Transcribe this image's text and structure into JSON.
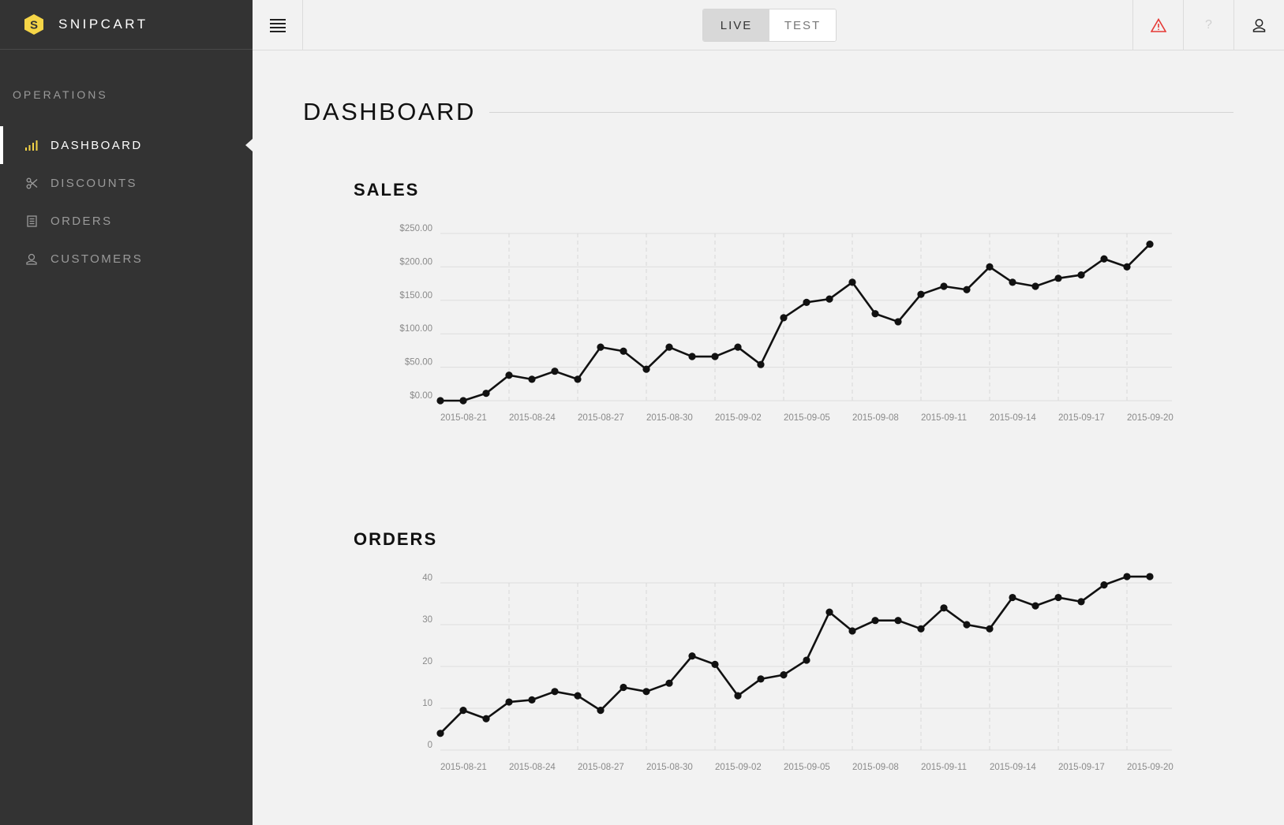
{
  "app": {
    "brand": "SNIPCART",
    "accent": "#f5d547"
  },
  "sidebar": {
    "section_label": "OPERATIONS",
    "items": [
      {
        "label": "DASHBOARD",
        "icon": "bar-chart-icon",
        "active": true
      },
      {
        "label": "DISCOUNTS",
        "icon": "scissors-icon",
        "active": false
      },
      {
        "label": "ORDERS",
        "icon": "receipt-icon",
        "active": false
      },
      {
        "label": "CUSTOMERS",
        "icon": "user-icon",
        "active": false
      }
    ]
  },
  "topbar": {
    "mode_live": "LIVE",
    "mode_test": "TEST",
    "selected_mode": "LIVE",
    "icons": [
      "menu-icon",
      "alert-icon",
      "help-icon",
      "user-icon"
    ],
    "help_glyph": "?",
    "alert_color": "#e53935"
  },
  "main": {
    "page_title": "DASHBOARD"
  },
  "charts": {
    "sales_title": "SALES",
    "orders_title": "ORDERS"
  },
  "chart_data": [
    {
      "type": "line",
      "title": "SALES",
      "x_ticks": [
        "2015-08-21",
        "2015-08-24",
        "2015-08-27",
        "2015-08-30",
        "2015-09-02",
        "2015-09-05",
        "2015-09-08",
        "2015-09-11",
        "2015-09-14",
        "2015-09-17",
        "2015-09-20"
      ],
      "y_ticks": [
        "$0.00",
        "$50.00",
        "$100.00",
        "$150.00",
        "$200.00",
        "$250.00"
      ],
      "ylim": [
        0,
        250
      ],
      "x": [
        "2015-08-21",
        "2015-08-22",
        "2015-08-23",
        "2015-08-24",
        "2015-08-25",
        "2015-08-26",
        "2015-08-27",
        "2015-08-28",
        "2015-08-29",
        "2015-08-30",
        "2015-08-31",
        "2015-09-01",
        "2015-09-02",
        "2015-09-03",
        "2015-09-04",
        "2015-09-05",
        "2015-09-06",
        "2015-09-07",
        "2015-09-08",
        "2015-09-09",
        "2015-09-10",
        "2015-09-11",
        "2015-09-12",
        "2015-09-13",
        "2015-09-14",
        "2015-09-15",
        "2015-09-16",
        "2015-09-17",
        "2015-09-18",
        "2015-09-19",
        "2015-09-20",
        "2015-09-21"
      ],
      "values": [
        0,
        0,
        11,
        38,
        32,
        44,
        32,
        80,
        74,
        47,
        80,
        66,
        66,
        80,
        54,
        124,
        147,
        152,
        177,
        130,
        118,
        159,
        171,
        166,
        200,
        177,
        171,
        183,
        188,
        212,
        200,
        234
      ],
      "grid": true
    },
    {
      "type": "line",
      "title": "ORDERS",
      "x_ticks": [
        "2015-08-21",
        "2015-08-24",
        "2015-08-27",
        "2015-08-30",
        "2015-09-02",
        "2015-09-05",
        "2015-09-08",
        "2015-09-11",
        "2015-09-14",
        "2015-09-17",
        "2015-09-20"
      ],
      "y_ticks": [
        "0",
        "10",
        "20",
        "30",
        "40"
      ],
      "ylim": [
        0,
        40
      ],
      "x": [
        "2015-08-21",
        "2015-08-22",
        "2015-08-23",
        "2015-08-24",
        "2015-08-25",
        "2015-08-26",
        "2015-08-27",
        "2015-08-28",
        "2015-08-29",
        "2015-08-30",
        "2015-08-31",
        "2015-09-01",
        "2015-09-02",
        "2015-09-03",
        "2015-09-04",
        "2015-09-05",
        "2015-09-06",
        "2015-09-07",
        "2015-09-08",
        "2015-09-09",
        "2015-09-10",
        "2015-09-11",
        "2015-09-12",
        "2015-09-13",
        "2015-09-14",
        "2015-09-15",
        "2015-09-16",
        "2015-09-17",
        "2015-09-18",
        "2015-09-19",
        "2015-09-20",
        "2015-09-21"
      ],
      "values": [
        4,
        9.5,
        7.5,
        11.5,
        12,
        14,
        13,
        9.5,
        15,
        14,
        16,
        22.5,
        20.5,
        13,
        17,
        18,
        21.5,
        33,
        28.5,
        31,
        31,
        29,
        34,
        30,
        29,
        36.5,
        34.5,
        36.5,
        35.5,
        39.5,
        41.5,
        41.5
      ],
      "grid": true
    }
  ]
}
